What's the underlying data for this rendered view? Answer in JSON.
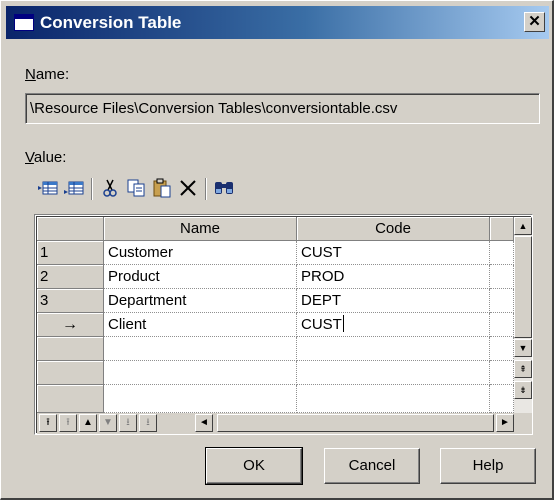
{
  "window": {
    "title": "Conversion Table",
    "close_label": "✕"
  },
  "name_field": {
    "label_mnemonic": "N",
    "label_rest": "ame:",
    "value": "\\Resource Files\\Conversion Tables\\conversiontable.csv"
  },
  "value_label": {
    "mnemonic": "V",
    "rest": "alue:"
  },
  "toolbar": {
    "icons": [
      "insert-row-icon",
      "add-row-icon",
      "cut-icon",
      "copy-icon",
      "paste-icon",
      "delete-icon",
      "find-icon"
    ]
  },
  "grid": {
    "columns": [
      "Name",
      "Code"
    ],
    "rows": [
      {
        "num": "1",
        "name": "Customer",
        "code": "CUST"
      },
      {
        "num": "2",
        "name": "Product",
        "code": "PROD"
      },
      {
        "num": "3",
        "name": "Department",
        "code": "DEPT"
      },
      {
        "num": "→",
        "name": "Client",
        "code": "CUST"
      }
    ],
    "empty_rows": 3
  },
  "scroll": {
    "up": "▲",
    "down": "▼",
    "left": "◄",
    "right": "►",
    "page_top": "⇞",
    "page_bottom": "⇟"
  },
  "nav_buttons": [
    "⭱",
    "⭱",
    "▲",
    "▼",
    "⭳",
    "⭳"
  ],
  "buttons": {
    "ok": "OK",
    "cancel": "Cancel",
    "help": "Help"
  }
}
